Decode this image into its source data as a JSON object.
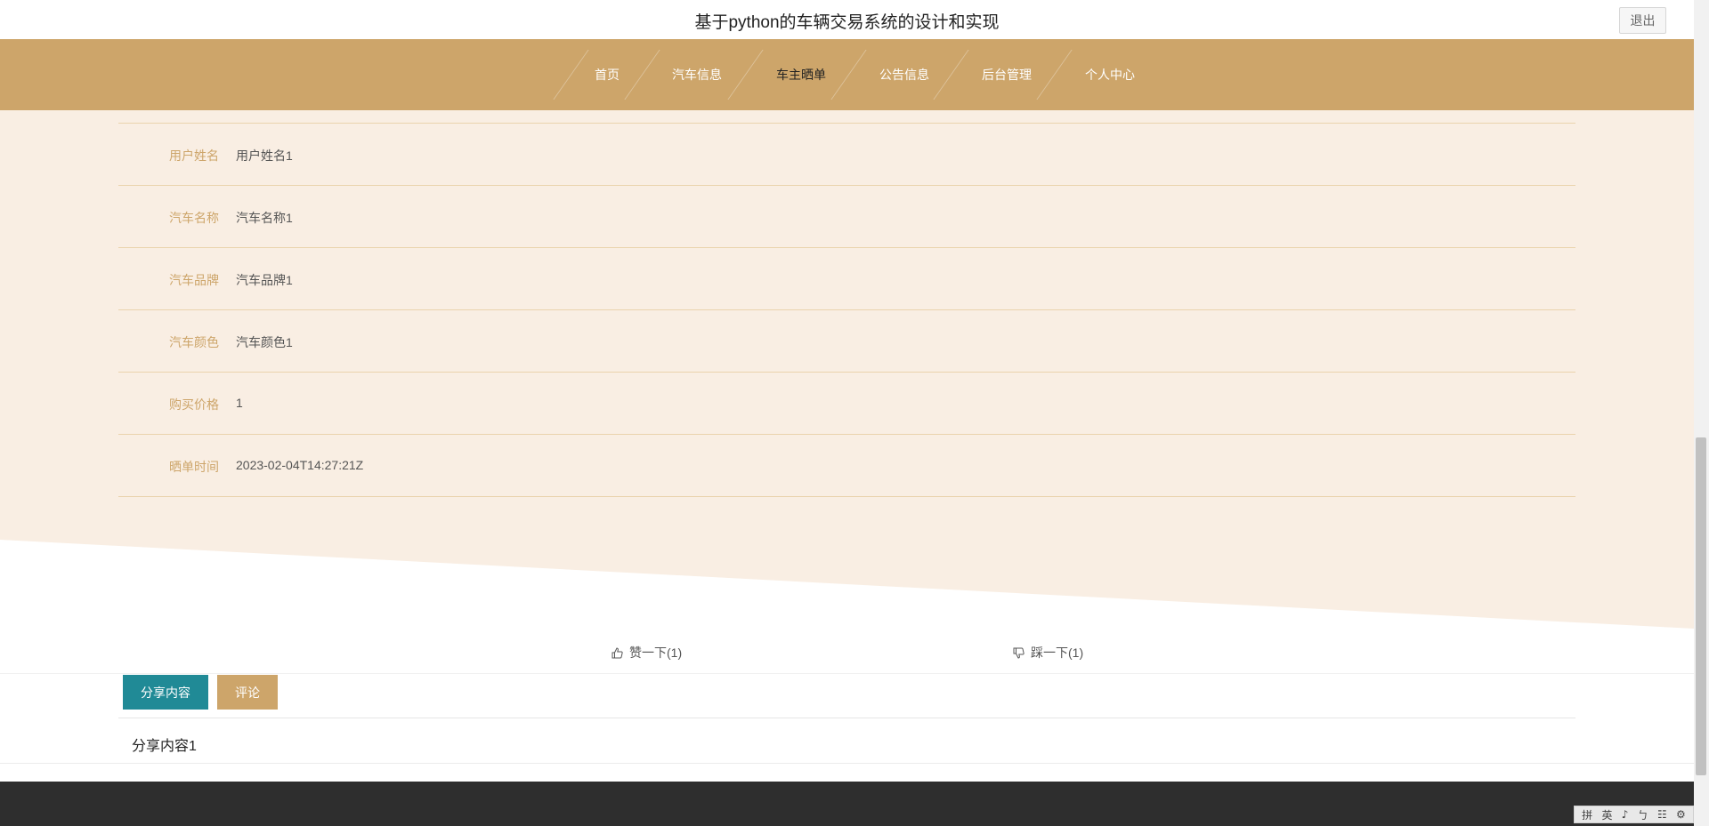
{
  "header": {
    "site_title": "基于python的车辆交易系统的设计和实现",
    "logout_label": "退出"
  },
  "nav": {
    "items": [
      {
        "label": "首页",
        "active": false
      },
      {
        "label": "汽车信息",
        "active": false
      },
      {
        "label": "车主晒单",
        "active": true
      },
      {
        "label": "公告信息",
        "active": false
      },
      {
        "label": "后台管理",
        "active": false
      },
      {
        "label": "个人中心",
        "active": false
      }
    ]
  },
  "detail": {
    "rows": [
      {
        "label": "用户姓名",
        "value": "用户姓名1"
      },
      {
        "label": "汽车名称",
        "value": "汽车名称1"
      },
      {
        "label": "汽车品牌",
        "value": "汽车品牌1"
      },
      {
        "label": "汽车颜色",
        "value": "汽车颜色1"
      },
      {
        "label": "购买价格",
        "value": "1"
      },
      {
        "label": "晒单时间",
        "value": "2023-02-04T14:27:21Z"
      }
    ]
  },
  "votes": {
    "like_label": "赞一下(1)",
    "dislike_label": "踩一下(1)"
  },
  "tabs": {
    "share_label": "分享内容",
    "comment_label": "评论"
  },
  "share_content": "分享内容1",
  "ime": {
    "glyphs": [
      "拼",
      "英",
      "♪",
      "ㄅ",
      "☷",
      "⚙"
    ]
  },
  "colors": {
    "accent": "#cda56a",
    "panel_bg": "#f9eee3",
    "teal": "#208a96",
    "footer": "#2e2e2e"
  }
}
